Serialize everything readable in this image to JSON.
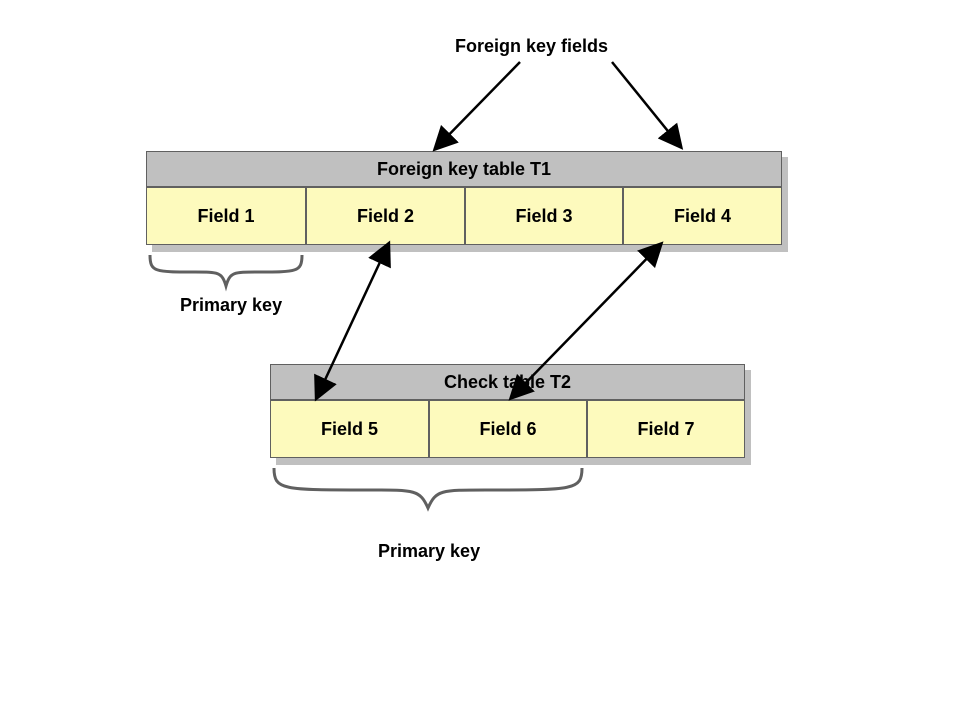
{
  "labels": {
    "topLabel": "Foreign key fields",
    "primaryKeyT1": "Primary key",
    "primaryKeyT2": "Primary key"
  },
  "tableT1": {
    "title": "Foreign key table T1",
    "fields": [
      "Field 1",
      "Field 2",
      "Field 3",
      "Field 4"
    ]
  },
  "tableT2": {
    "title": "Check table    T2",
    "fields": [
      "Field 5",
      "Field 6",
      "Field 7"
    ]
  }
}
